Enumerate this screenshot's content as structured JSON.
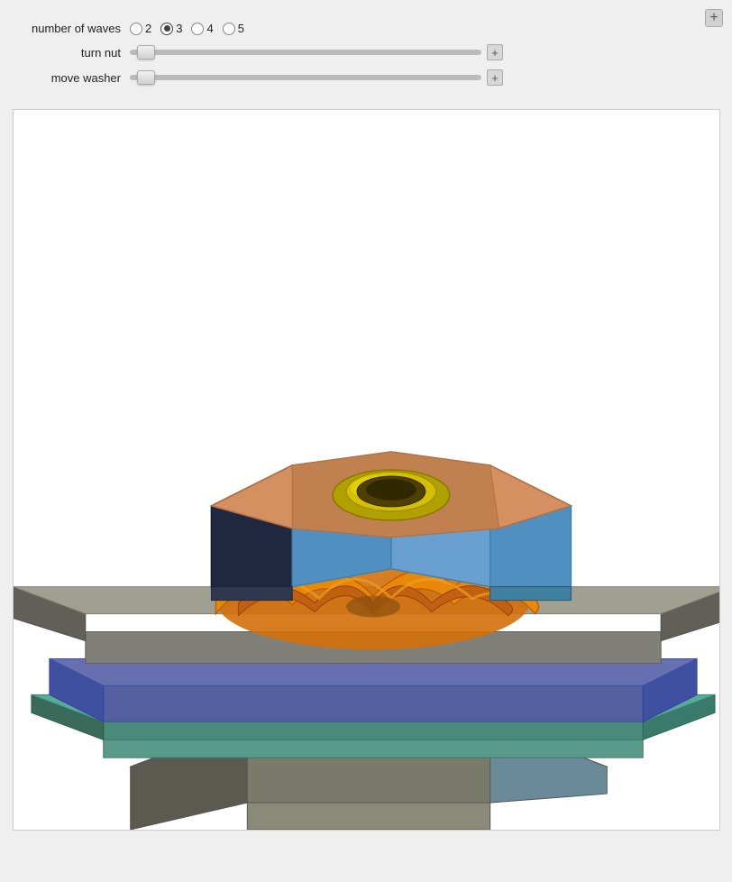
{
  "topButton": {
    "label": "+"
  },
  "controls": {
    "wavesLabel": "number of waves",
    "waveOptions": [
      {
        "value": "2",
        "selected": false
      },
      {
        "value": "3",
        "selected": true
      },
      {
        "value": "4",
        "selected": false
      },
      {
        "value": "5",
        "selected": false
      }
    ],
    "turnNutLabel": "turn nut",
    "moveWasherLabel": "move washer",
    "sliderPlusLabel": "+"
  }
}
